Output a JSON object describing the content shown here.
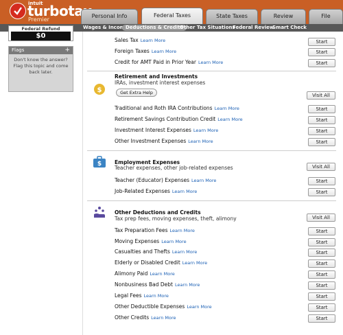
{
  "brand": {
    "intuit": "intuit",
    "name": "turbotax",
    "edition": "Premier"
  },
  "tabs": [
    "Personal Info",
    "Federal Taxes",
    "State Taxes",
    "Review",
    "File"
  ],
  "subnav": [
    "Wages & Income",
    "Deductions & Credits",
    "Other Tax Situations",
    "Federal Review",
    "Smart Check"
  ],
  "refund": {
    "label": "Federal Refund",
    "value": "$0"
  },
  "flags": {
    "title": "Flags",
    "plus": "+",
    "help": "Don't know the answer? Flag this topic and come back later."
  },
  "learn_more": "Learn More",
  "start": "Start",
  "visit_all": "Visit All",
  "top_rows": [
    "Sales Tax",
    "Foreign Taxes",
    "Credit for AMT Paid in Prior Year"
  ],
  "retirement": {
    "title": "Retirement and Investments",
    "desc": "IRAs, investment interest expenses",
    "extra_help": "Get Extra Help",
    "rows": [
      "Traditional and Roth IRA Contributions",
      "Retirement Savings Contribution Credit",
      "Investment Interest Expenses",
      "Other Investment Expenses"
    ]
  },
  "employment": {
    "title": "Employment Expenses",
    "desc": "Teacher expenses, other job-related expenses",
    "rows": [
      "Teacher (Educator) Expenses",
      "Job-Related Expenses"
    ]
  },
  "other": {
    "title": "Other Deductions and Credits",
    "desc": "Tax prep fees, moving expenses, theft, alimony",
    "rows": [
      "Tax Preparation Fees",
      "Moving Expenses",
      "Casualties and Thefts",
      "Elderly or Disabled Credit",
      "Alimony Paid",
      "Nonbusiness Bad Debt",
      "Legal Fees",
      "Other Deductible Expenses",
      "Other Credits"
    ]
  },
  "colors": {
    "header": "#c95f25",
    "link": "#1a5fb4",
    "subnav": "#585858"
  }
}
